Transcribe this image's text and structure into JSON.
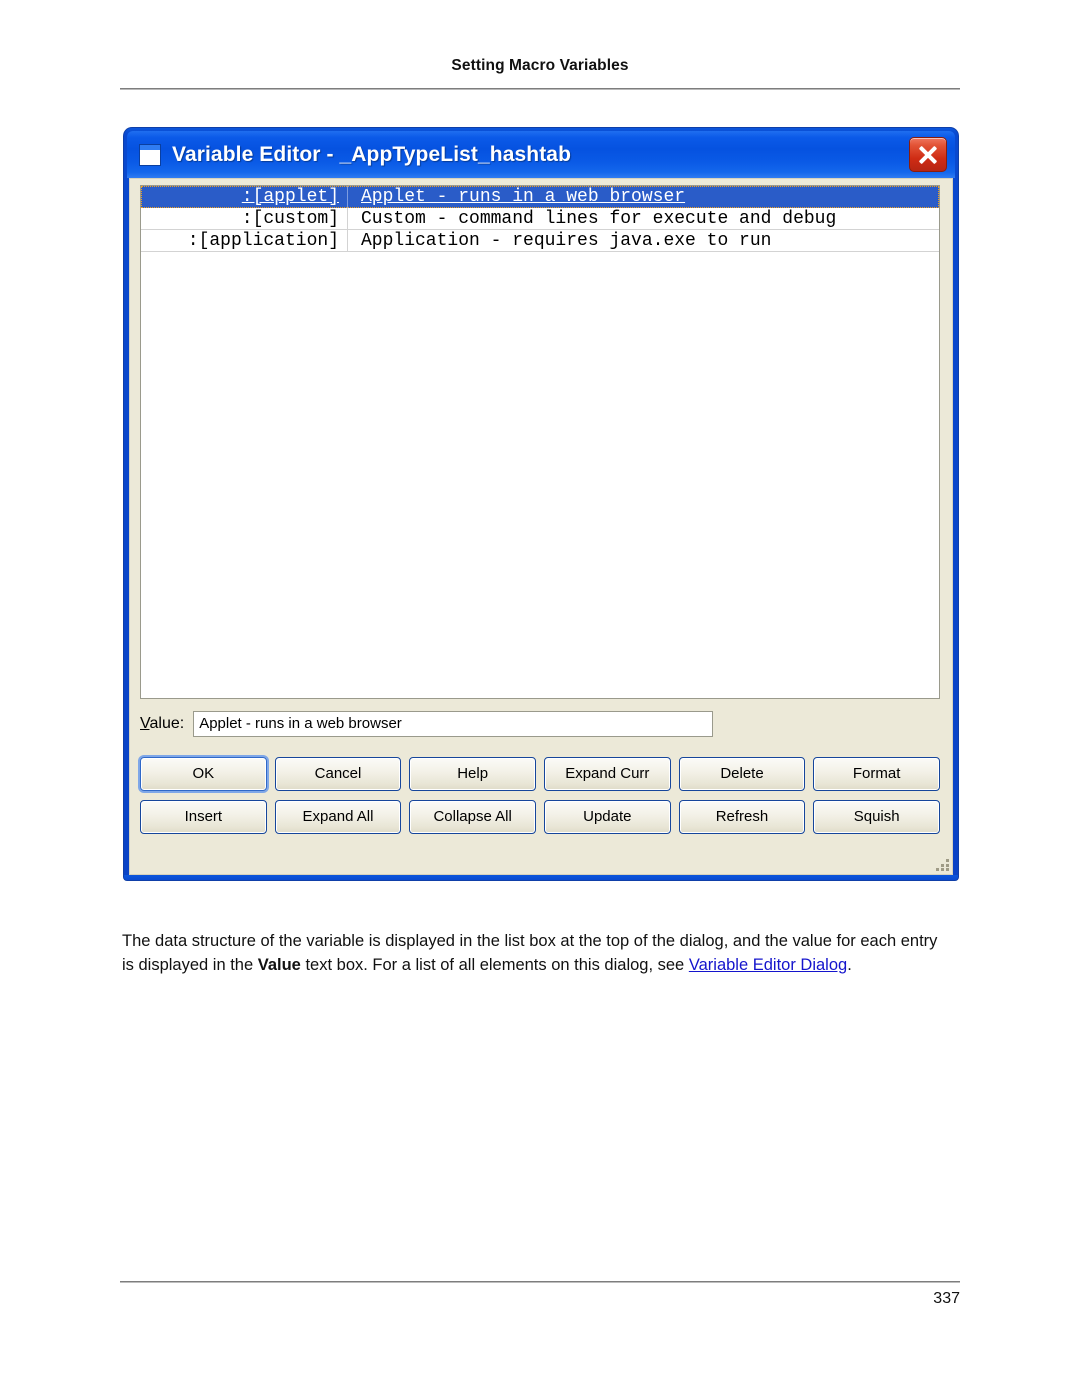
{
  "page": {
    "header_title": "Setting Macro Variables",
    "page_number": "337"
  },
  "dialog": {
    "title": "Variable Editor - _AppTypeList_hashtab",
    "close_label": "Close",
    "listbox": {
      "rows": [
        {
          "key": ":[applet]",
          "description": "Applet - runs in a web browser",
          "selected": true
        },
        {
          "key": ":[custom]",
          "description": "Custom - command lines for execute and debug",
          "selected": false
        },
        {
          "key": ":[application]",
          "description": "Application - requires java.exe to run",
          "selected": false
        }
      ]
    },
    "value_field": {
      "label_accel": "V",
      "label_rest": "alue:",
      "value": "Applet - runs in a web browser",
      "placeholder": ""
    },
    "buttons": [
      {
        "label": "OK",
        "name": "ok-button",
        "default": true
      },
      {
        "label": "Cancel",
        "name": "cancel-button",
        "default": false
      },
      {
        "label": "Help",
        "name": "help-button",
        "default": false
      },
      {
        "label": "Expand Curr",
        "name": "expand-curr-button",
        "default": false
      },
      {
        "label": "Delete",
        "name": "delete-button",
        "default": false
      },
      {
        "label": "Format",
        "name": "format-button",
        "default": false
      },
      {
        "label": "Insert",
        "name": "insert-button",
        "default": false
      },
      {
        "label": "Expand All",
        "name": "expand-all-button",
        "default": false
      },
      {
        "label": "Collapse All",
        "name": "collapse-all-button",
        "default": false
      },
      {
        "label": "Update",
        "name": "update-button",
        "default": false
      },
      {
        "label": "Refresh",
        "name": "refresh-button",
        "default": false
      },
      {
        "label": "Squish",
        "name": "squish-button",
        "default": false
      }
    ]
  },
  "body_copy": {
    "part1": "The data structure of the variable is displayed in the list box at the top of the dialog, and the value for each entry is displayed in the ",
    "bold1": "Value",
    "part2": " text box. For a list of all elements on this dialog, see ",
    "link": "Variable Editor Dialog",
    "part3": "."
  },
  "colors": {
    "title_bar_blue": "#0652e0",
    "dialog_face": "#ece9d8",
    "selection_blue": "#2a5cc8",
    "close_red": "#cf2c14",
    "link_blue": "#1414cc"
  }
}
